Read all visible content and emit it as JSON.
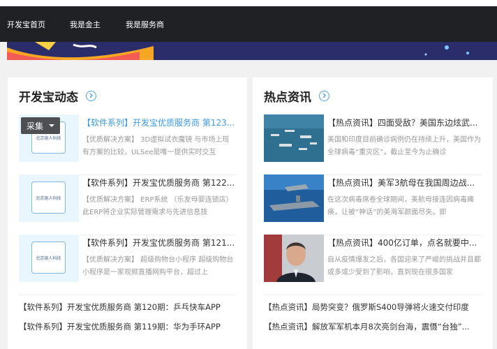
{
  "nav": {
    "items": [
      {
        "label": "开发宝首页"
      },
      {
        "label": "我是金主"
      },
      {
        "label": "我是服务商"
      }
    ]
  },
  "left": {
    "title": "开发宝动态",
    "rows": [
      {
        "title": "【软件系列】开发宝优质服务商 第123...",
        "desc": "【优质解决方案】 3D虚拟试衣魔镜 与市场上现有方案的比较，ULSee是唯一提供实时交互",
        "thumb_text": "北京施人科技"
      },
      {
        "title": "【软件系列】开发宝优质服务商 第122...",
        "desc": "【优质解决方案】 ERP系统 （乐友母婴连锁店） 此ERP将企业实际管理需求与先进信息技",
        "thumb_text": "北京施人科技"
      },
      {
        "title": "【软件系列】开发宝优质服务商 第121...",
        "desc": "【优质解决方案】 超级购物台小程序 超级购物台小程序是一家视频直播网购平台，超过上",
        "thumb_text": "北京施人科技"
      }
    ],
    "lines": [
      "【软件系列】开发宝优质服务商 第120期：乒乓快车APP",
      "【软件系列】开发宝优质服务商 第119期：华为手环APP"
    ]
  },
  "right": {
    "title": "热点资讯",
    "rows": [
      {
        "title": "【热点资讯】四面受敌？美国东边炫武...",
        "desc": "美国和印度目前确诊病例仍在持续上升，美国作为全球病毒“重灾区”，截止至今为止确诊"
      },
      {
        "title": "【热点资讯】美军3航母在我国周边战...",
        "desc": "在这次病毒席卷全球期间，美航母接连因病毒瘫痪，让被“神话”的美海军颜面尽失。即"
      },
      {
        "title": "【热点资讯】400亿订单，点名就要中...",
        "desc": "自从疫情爆发之后，各国迎来了严峻的挑战并且都或多或少受到了影响，直到现在很多国家"
      }
    ],
    "lines": [
      "【热点资讯】局势突变？俄罗斯S400导弹将火速交付印度",
      "【热点资讯】解放军军机本月8次亮剑台海，震慑“台独”..."
    ]
  },
  "collect_button": {
    "label": "采集"
  }
}
